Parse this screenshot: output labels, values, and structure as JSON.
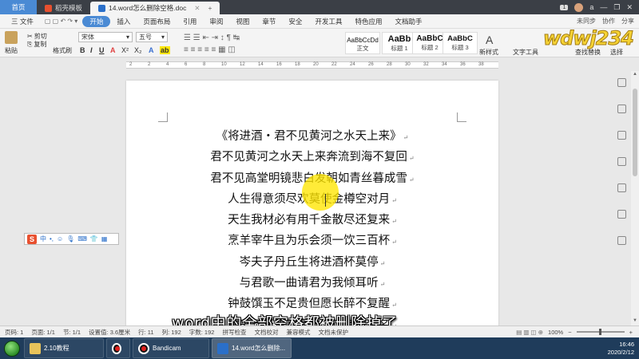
{
  "tabs": {
    "home": "首页",
    "template": "稻壳模板",
    "document": "14.word怎么删除空格.doc",
    "badge": "1",
    "user": "a"
  },
  "menubar": {
    "file": "三 文件",
    "items": [
      "开始",
      "插入",
      "页面布局",
      "引用",
      "审阅",
      "视图",
      "章节",
      "安全",
      "开发工具",
      "特色应用",
      "文档助手"
    ],
    "right": [
      "未同步",
      "协作",
      "分享"
    ]
  },
  "ribbon": {
    "paste": "粘贴",
    "cut": "剪切",
    "copy": "复制",
    "format_painter": "格式刷",
    "font_name": "宋体",
    "font_size": "五号",
    "styles": [
      {
        "sample": "AaBbCcDd",
        "label": "正文"
      },
      {
        "sample": "AaBb",
        "label": "标题 1"
      },
      {
        "sample": "AaBbC",
        "label": "标题 2"
      },
      {
        "sample": "AaBbC",
        "label": "标题 3"
      }
    ],
    "new_style": "新样式",
    "text_tools": "文字工具",
    "find_replace": "查找替换",
    "select": "选择",
    "logo_text": "wdwj234"
  },
  "ruler": {
    "ticks": [
      "2",
      "2",
      "4",
      "6",
      "8",
      "10",
      "12",
      "14",
      "16",
      "18",
      "20",
      "22",
      "24",
      "26",
      "28",
      "30",
      "32",
      "34",
      "36",
      "38"
    ]
  },
  "document": {
    "lines": [
      "《将进酒・君不见黄河之水天上来》",
      "君不见黄河之水天上来奔流到海不复回",
      "君不见高堂明镜悲白发朝如青丝暮成雪",
      "人生得意须尽欢莫使金樽空对月",
      "天生我材必有用千金散尽还复来",
      "烹羊宰牛且为乐会须一饮三百杯",
      "岑夫子丹丘生将进酒杯莫停",
      "与君歌一曲请君为我倾耳听",
      "钟鼓馔玉不足贵但愿长醉不复醒",
      "古来圣贤皆寂寞惟有饮者留其名"
    ],
    "para_mark": "↵"
  },
  "caption": "word中的全部空格都被删除掉了",
  "statusbar": {
    "page": "页码: 1",
    "pages": "页面: 1/1",
    "section": "节: 1/1",
    "position": "设置值: 3.6厘米",
    "row": "行: 11",
    "col": "列: 192",
    "words": "字数: 192",
    "spell": "拼写检查",
    "proof": "文档校对",
    "mode": "兼容模式",
    "protect": "文档未保护",
    "zoom": "100%"
  },
  "taskbar": {
    "items": [
      "2.10教程",
      "",
      "Bandicam",
      "14.word怎么删除..."
    ],
    "time": "16:46",
    "date": "2020/2/12"
  },
  "colors": {
    "accent": "#4a8ad4",
    "highlight": "#ffe600",
    "taskbar": "#1f3c5b"
  }
}
